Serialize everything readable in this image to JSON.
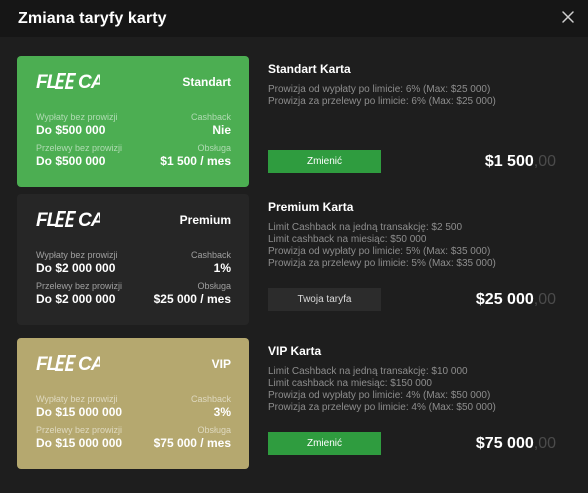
{
  "window": {
    "title": "Zmiana taryfy karty"
  },
  "cards": [
    {
      "tier": "Standart",
      "brand": "FLEECA",
      "withdraw_label": "Wypłaty bez prowizji",
      "withdraw_value": "Do $500 000",
      "cashback_label": "Cashback",
      "cashback_value": "Nie",
      "transfer_label": "Przelewy bez prowizji",
      "transfer_value": "Do $500 000",
      "fee_label": "Obsługa",
      "fee_value": "$1 500 / mes",
      "info_title": "Standart Karta",
      "info_lines": [
        "Prowizja od wypłaty po limicie: 6% (Max: $25 000)",
        "Prowizja za przelewy po limicie: 6% (Max: $25 000)"
      ],
      "button_label": "Zmienić",
      "price_main": "$1 500",
      "price_cents": ",00"
    },
    {
      "tier": "Premium",
      "brand": "FLEECA",
      "withdraw_label": "Wypłaty bez prowizji",
      "withdraw_value": "Do $2 000 000",
      "cashback_label": "Cashback",
      "cashback_value": "1%",
      "transfer_label": "Przelewy bez prowizji",
      "transfer_value": "Do $2 000 000",
      "fee_label": "Obsługa",
      "fee_value": "$25 000 / mes",
      "info_title": "Premium Karta",
      "info_lines": [
        "Limit Cashback na jedną transakcję: $2 500",
        "Limit cashback na miesiąc: $50 000",
        "Prowizja od wypłaty po limicie: 5% (Max: $35 000)",
        "Prowizja za przelewy po limicie: 5% (Max: $35 000)"
      ],
      "button_label": "Twoja taryfa",
      "price_main": "$25 000",
      "price_cents": ",00"
    },
    {
      "tier": "VIP",
      "brand": "FLEECA",
      "withdraw_label": "Wypłaty bez prowizji",
      "withdraw_value": "Do $15 000 000",
      "cashback_label": "Cashback",
      "cashback_value": "3%",
      "transfer_label": "Przelewy bez prowizji",
      "transfer_value": "Do $15 000 000",
      "fee_label": "Obsługa",
      "fee_value": "$75 000 / mes",
      "info_title": "VIP Karta",
      "info_lines": [
        "Limit Cashback na jedną transakcję: $10 000",
        "Limit cashback na miesiąc: $150 000",
        "Prowizja od wypłaty po limicie: 4% (Max: $50 000)",
        "Prowizja za przelewy po limicie: 4% (Max: $50 000)"
      ],
      "button_label": "Zmienić",
      "price_main": "$75 000",
      "price_cents": ",00"
    }
  ],
  "colors": {
    "standart_card": "#4cae52",
    "premium_card": "#262626",
    "vip_card": "#b5a86f",
    "action_button": "#2f9c3f"
  }
}
